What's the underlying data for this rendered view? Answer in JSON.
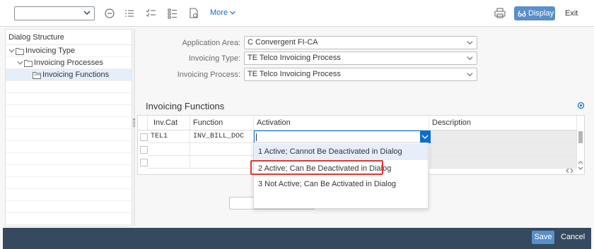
{
  "toolbar": {
    "more_label": "More",
    "display_label": "Display",
    "exit_label": "Exit"
  },
  "dialog_structure": {
    "title": "Dialog Structure",
    "items": [
      {
        "label": "Invoicing Type"
      },
      {
        "label": "Invoicing Processes"
      },
      {
        "label": "Invoicing Functions"
      }
    ]
  },
  "form": {
    "application_area_label": "Application Area:",
    "application_area_value": "C Convergent FI-CA",
    "invoicing_type_label": "Invoicing Type:",
    "invoicing_type_value": "TE Telco Invoicing Process",
    "invoicing_process_label": "Invoicing Process:",
    "invoicing_process_value": "TE Telco Invoicing Process"
  },
  "table": {
    "title": "Invoicing Functions",
    "columns": [
      "Inv.Cat",
      "Function",
      "Activation",
      "Description"
    ],
    "rows": [
      {
        "inv_cat": "TEL1",
        "function": "INV_BILL_DOC",
        "activation": "",
        "description": ""
      }
    ]
  },
  "activation_dropdown": {
    "options": [
      "1 Active; Cannot Be Deactivated in Dialog",
      "2 Active; Can Be Deactivated in Dialog",
      "3 Not Active; Can Be Activated in Dialog"
    ],
    "highlighted_index": 0,
    "marked_index": 1
  },
  "footer": {
    "save_label": "Save",
    "cancel_label": "Cancel"
  },
  "colors": {
    "accent": "#0a6ed1",
    "button": "#5a8fc9",
    "footer": "#354a5f",
    "marker": "#e0382f"
  }
}
